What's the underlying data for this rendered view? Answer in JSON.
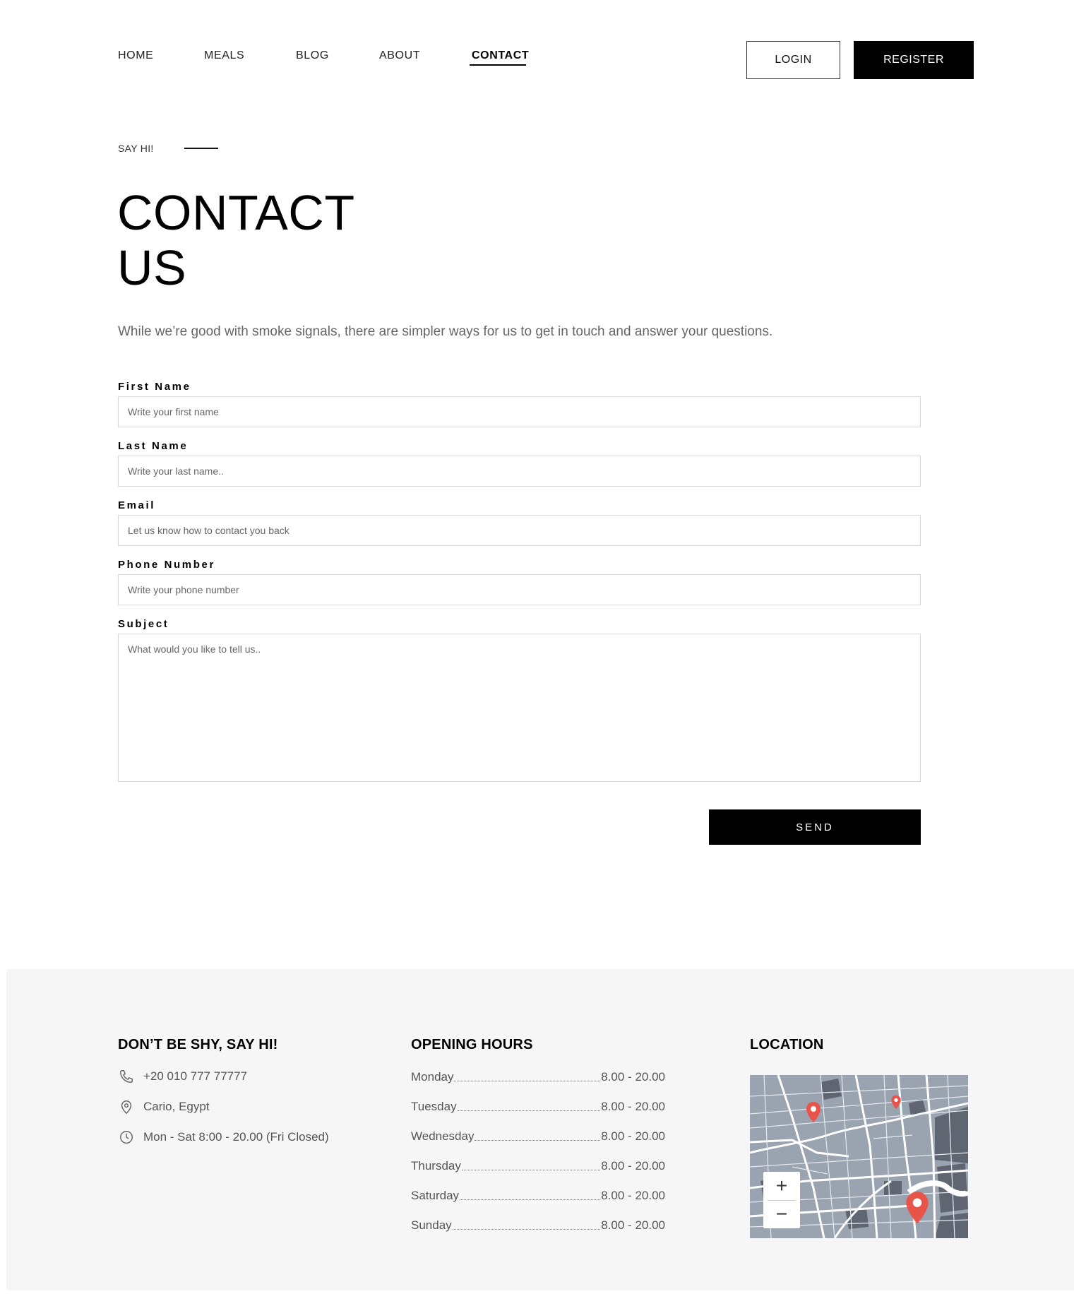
{
  "nav": {
    "links": [
      "HOME",
      "MEALS",
      "BLOG",
      "ABOUT",
      "CONTACT"
    ],
    "active": "CONTACT",
    "login": "LOGIN",
    "register": "REGISTER"
  },
  "hero": {
    "eyebrow": "SAY HI!",
    "title_line1": "CONTACT",
    "title_line2": "US",
    "intro": "While we’re good with smoke signals, there are simpler ways for us to get in touch and answer your questions."
  },
  "form": {
    "first_name": {
      "label": "First Name",
      "placeholder": "Write your first name",
      "value": ""
    },
    "last_name": {
      "label": "Last Name",
      "placeholder": "Write your last name..",
      "value": ""
    },
    "email": {
      "label": "Email",
      "placeholder": "Let us know how to contact you back",
      "value": ""
    },
    "phone": {
      "label": "Phone Number",
      "placeholder": "Write your phone number",
      "value": ""
    },
    "subject": {
      "label": "Subject",
      "placeholder": "What would you like to tell us..",
      "value": ""
    },
    "send": "SEND"
  },
  "footer": {
    "contact": {
      "heading": "DON’T BE SHY, SAY HI!",
      "phone": "+20 010 777 77777",
      "address": "Cario, Egypt",
      "hours": "Mon - Sat 8:00 - 20.00 (Fri Closed)"
    },
    "opening": {
      "heading": "OPENING HOURS",
      "rows": [
        {
          "day": "Monday",
          "time": "8.00 - 20.00"
        },
        {
          "day": "Tuesday",
          "time": "8.00 - 20.00"
        },
        {
          "day": "Wednesday",
          "time": "8.00 - 20.00"
        },
        {
          "day": "Thursday",
          "time": "8.00 - 20.00"
        },
        {
          "day": "Saturday",
          "time": "8.00 - 20.00"
        },
        {
          "day": "Sunday",
          "time": "8.00 - 20.00"
        }
      ]
    },
    "location": {
      "heading": "LOCATION",
      "zoom_in": "+",
      "zoom_out": "−",
      "pin_color": "#e8534a",
      "map_bg": "#9aa3b0"
    }
  },
  "icons": [
    "phone-icon",
    "location-pin-icon",
    "clock-icon"
  ]
}
